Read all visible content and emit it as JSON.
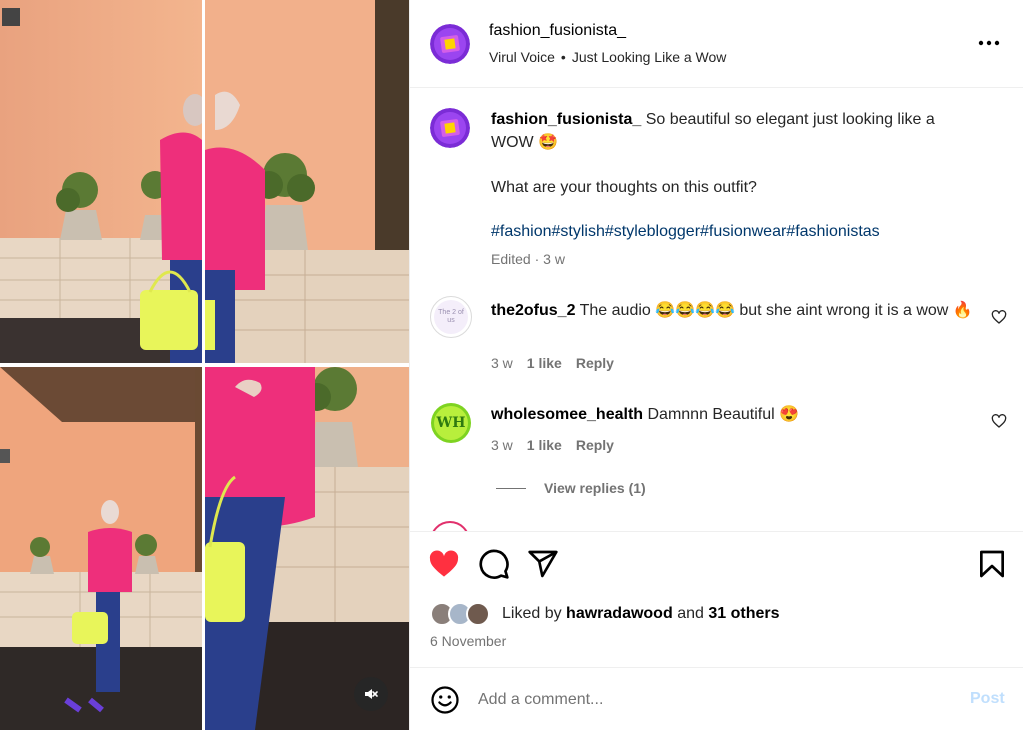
{
  "post": {
    "username": "fashion_fusionista_",
    "audio_artist": "Virul Voice",
    "audio_separator": "•",
    "audio_track": "Just Looking Like a Wow",
    "caption_line1": "So beautiful so elegant just looking like a WOW 🤩",
    "caption_line2": "What are your thoughts on this outfit?",
    "hashtags": "#fashion#stylish#styleblogger#fusionwear#fashionistas",
    "caption_meta": "Edited · 3 w",
    "likes_prefix": "Liked by",
    "liked_by_user": "hawradawood",
    "likes_conjunction": "and",
    "likes_others": "31 others",
    "date": "6 November"
  },
  "comments": [
    {
      "username": "the2ofus_2",
      "avatar_text": "The 2 of us",
      "text": "The audio 😂😂😂😂 but she aint wrong it is a wow 🔥",
      "time": "3 w",
      "likes": "1 like",
      "reply": "Reply"
    },
    {
      "username": "wholesomee_health",
      "avatar_text": "WH",
      "text": "Damnnn Beautiful 😍",
      "time": "3 w",
      "likes": "1 like",
      "reply": "Reply"
    }
  ],
  "view_replies": "View replies (1)",
  "composer": {
    "placeholder": "Add a comment...",
    "post_label": "Post"
  },
  "colors": {
    "like_red": "#ff3040",
    "link_blue": "#00376b",
    "post_disabled": "#c0dffd",
    "wh_green": "#7ed321"
  },
  "icons": [
    "more-options-icon",
    "heart-icon",
    "comment-icon",
    "share-icon",
    "bookmark-icon",
    "emoji-icon",
    "muted-speaker-icon"
  ]
}
